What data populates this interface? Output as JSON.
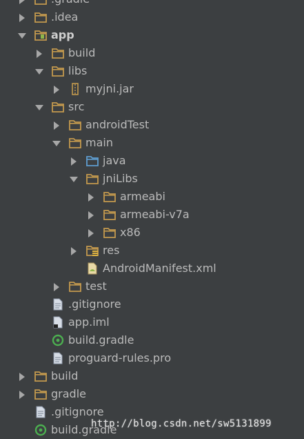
{
  "colors": {
    "background": "#3c3f41",
    "text": "#bbbbbb",
    "folder": "#c49a4e",
    "source_folder": "#5f9ed1",
    "arrow": "#a7a7a7"
  },
  "tree": {
    "items": [
      {
        "label": ".gradle",
        "depth": 0,
        "toggle": "collapsed",
        "icon": "folder-icon"
      },
      {
        "label": ".idea",
        "depth": 0,
        "toggle": "collapsed",
        "icon": "folder-icon"
      },
      {
        "label": "app",
        "depth": 0,
        "toggle": "expanded",
        "icon": "module-folder-icon",
        "bold": true
      },
      {
        "label": "build",
        "depth": 1,
        "toggle": "collapsed",
        "icon": "folder-icon"
      },
      {
        "label": "libs",
        "depth": 1,
        "toggle": "expanded",
        "icon": "folder-icon"
      },
      {
        "label": "myjni.jar",
        "depth": 2,
        "toggle": "collapsed",
        "icon": "jar-icon"
      },
      {
        "label": "src",
        "depth": 1,
        "toggle": "expanded",
        "icon": "folder-icon"
      },
      {
        "label": "androidTest",
        "depth": 2,
        "toggle": "collapsed",
        "icon": "folder-icon"
      },
      {
        "label": "main",
        "depth": 2,
        "toggle": "expanded",
        "icon": "folder-icon"
      },
      {
        "label": "java",
        "depth": 3,
        "toggle": "collapsed",
        "icon": "source-folder-icon"
      },
      {
        "label": "jniLibs",
        "depth": 3,
        "toggle": "expanded",
        "icon": "folder-icon"
      },
      {
        "label": "armeabi",
        "depth": 4,
        "toggle": "collapsed",
        "icon": "folder-icon"
      },
      {
        "label": "armeabi-v7a",
        "depth": 4,
        "toggle": "collapsed",
        "icon": "folder-icon"
      },
      {
        "label": "x86",
        "depth": 4,
        "toggle": "collapsed",
        "icon": "folder-icon"
      },
      {
        "label": "res",
        "depth": 3,
        "toggle": "collapsed",
        "icon": "resource-folder-icon"
      },
      {
        "label": "AndroidManifest.xml",
        "depth": 3,
        "toggle": "none",
        "icon": "manifest-icon"
      },
      {
        "label": "test",
        "depth": 2,
        "toggle": "collapsed",
        "icon": "folder-icon"
      },
      {
        "label": ".gitignore",
        "depth": 1,
        "toggle": "none",
        "icon": "text-file-icon"
      },
      {
        "label": "app.iml",
        "depth": 1,
        "toggle": "none",
        "icon": "iml-file-icon"
      },
      {
        "label": "build.gradle",
        "depth": 1,
        "toggle": "none",
        "icon": "gradle-icon"
      },
      {
        "label": "proguard-rules.pro",
        "depth": 1,
        "toggle": "none",
        "icon": "text-file-icon"
      },
      {
        "label": "build",
        "depth": 0,
        "toggle": "collapsed",
        "icon": "folder-icon"
      },
      {
        "label": "gradle",
        "depth": 0,
        "toggle": "collapsed",
        "icon": "folder-icon"
      },
      {
        "label": ".gitignore",
        "depth": 0,
        "toggle": "none",
        "icon": "text-file-icon"
      },
      {
        "label": "build.gradle",
        "depth": 0,
        "toggle": "none",
        "icon": "gradle-icon"
      }
    ]
  },
  "watermark": "http://blog.csdn.net/sw5131899"
}
